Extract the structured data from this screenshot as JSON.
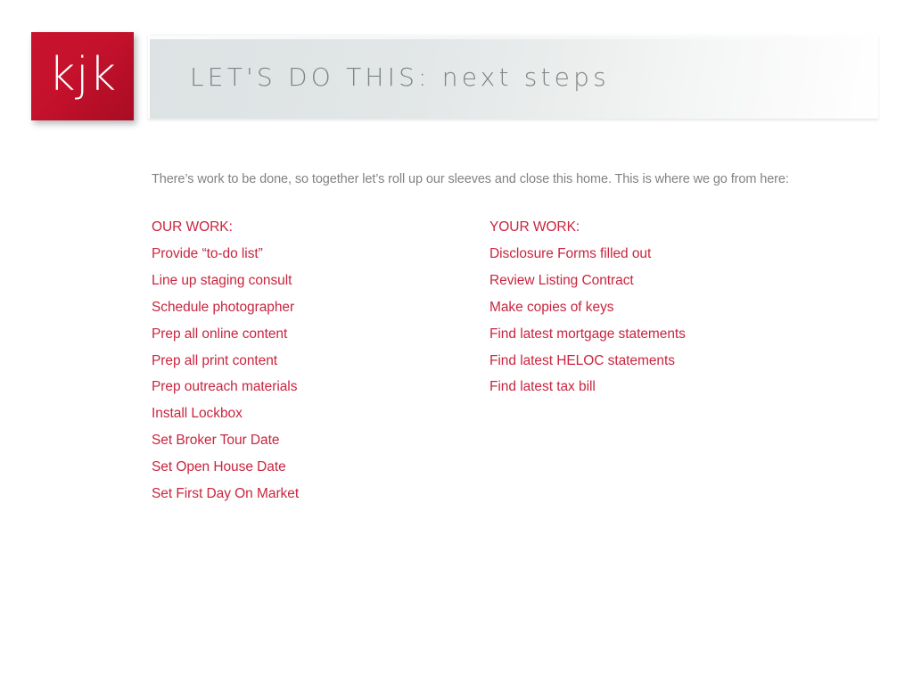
{
  "logo": {
    "text": "kjk",
    "background_color": "#c4112c",
    "text_color": "#ffffff"
  },
  "header": {
    "title": "LET'S DO THIS: next steps",
    "title_color": "#7e8386",
    "banner_color": "#dde3e4"
  },
  "body": {
    "intro": "There’s work to be done, so together let’s roll up our sleeves and close this home. This is where we go from here:",
    "intro_color": "#808285",
    "accent_color": "#c9253f"
  },
  "our_work": {
    "heading": "OUR WORK:",
    "items": [
      "Provide “to-do list”",
      "Line up staging consult",
      "Schedule photographer",
      "Prep all online content",
      "Prep all print content",
      "Prep outreach materials",
      "Install Lockbox",
      "Set Broker Tour Date",
      "Set Open House Date",
      "Set First Day On Market"
    ]
  },
  "your_work": {
    "heading": "YOUR WORK:",
    "items": [
      "Disclosure Forms filled out",
      "Review Listing Contract",
      "Make copies of keys",
      "Find latest mortgage statements",
      "Find latest HELOC statements",
      "Find latest tax bill"
    ]
  }
}
